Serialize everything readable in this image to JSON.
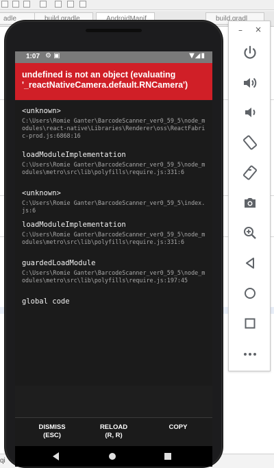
{
  "desktop": {
    "tabs": [
      "adle",
      "build.gradle",
      "AndroidManif",
      "build.gradl"
    ],
    "bottom_text": "qi"
  },
  "status_bar": {
    "time": "1:07",
    "left_icons": "⚙ ▣",
    "right_icons": "▼◢▮"
  },
  "error": {
    "title": "undefined is not an object (evaluating '_reactNativeCamera.default.RNCamera')"
  },
  "stack_frames": [
    {
      "method": "<unknown>",
      "file": "C:\\Users\\Romie Ganter\\BarcodeScanner_ver0_59_5\\node_modules\\react-native\\Libraries\\Renderer\\oss\\ReactFabric-prod.js:6868:16"
    },
    {
      "method": "loadModuleImplementation",
      "file": "C:\\Users\\Romie Ganter\\BarcodeScanner_ver0_59_5\\node_modules\\metro\\src\\lib\\polyfills\\require.js:331:6"
    },
    {
      "method": "<unknown>",
      "file": "C:\\Users\\Romie Ganter\\BarcodeScanner_ver0_59_5\\index.js:6"
    },
    {
      "method": "loadModuleImplementation",
      "file": "C:\\Users\\Romie Ganter\\BarcodeScanner_ver0_59_5\\node_modules\\metro\\src\\lib\\polyfills\\require.js:331:6"
    },
    {
      "method": "guardedLoadModule",
      "file": "C:\\Users\\Romie Ganter\\BarcodeScanner_ver0_59_5\\node_modules\\metro\\src\\lib\\polyfills\\require.js:197:45"
    },
    {
      "method": "global code",
      "file": ""
    }
  ],
  "buttons": {
    "dismiss": {
      "line1": "DISMISS",
      "line2": "(ESC)"
    },
    "reload": {
      "line1": "RELOAD",
      "line2": "(R, R)"
    },
    "copy": {
      "line1": "COPY",
      "line2": ""
    }
  },
  "toolbar": {
    "minimize": "–",
    "close": "×",
    "icons": [
      "power-icon",
      "volume-up-icon",
      "volume-down-icon",
      "rotate-left-icon",
      "rotate-right-icon",
      "camera-icon",
      "zoom-icon",
      "back-icon",
      "home-icon",
      "overview-icon",
      "more-icon"
    ]
  },
  "colors": {
    "error_red": "#d01f27",
    "screen_bg": "#1b1b1b",
    "toolbar_icon": "#5f6368"
  }
}
